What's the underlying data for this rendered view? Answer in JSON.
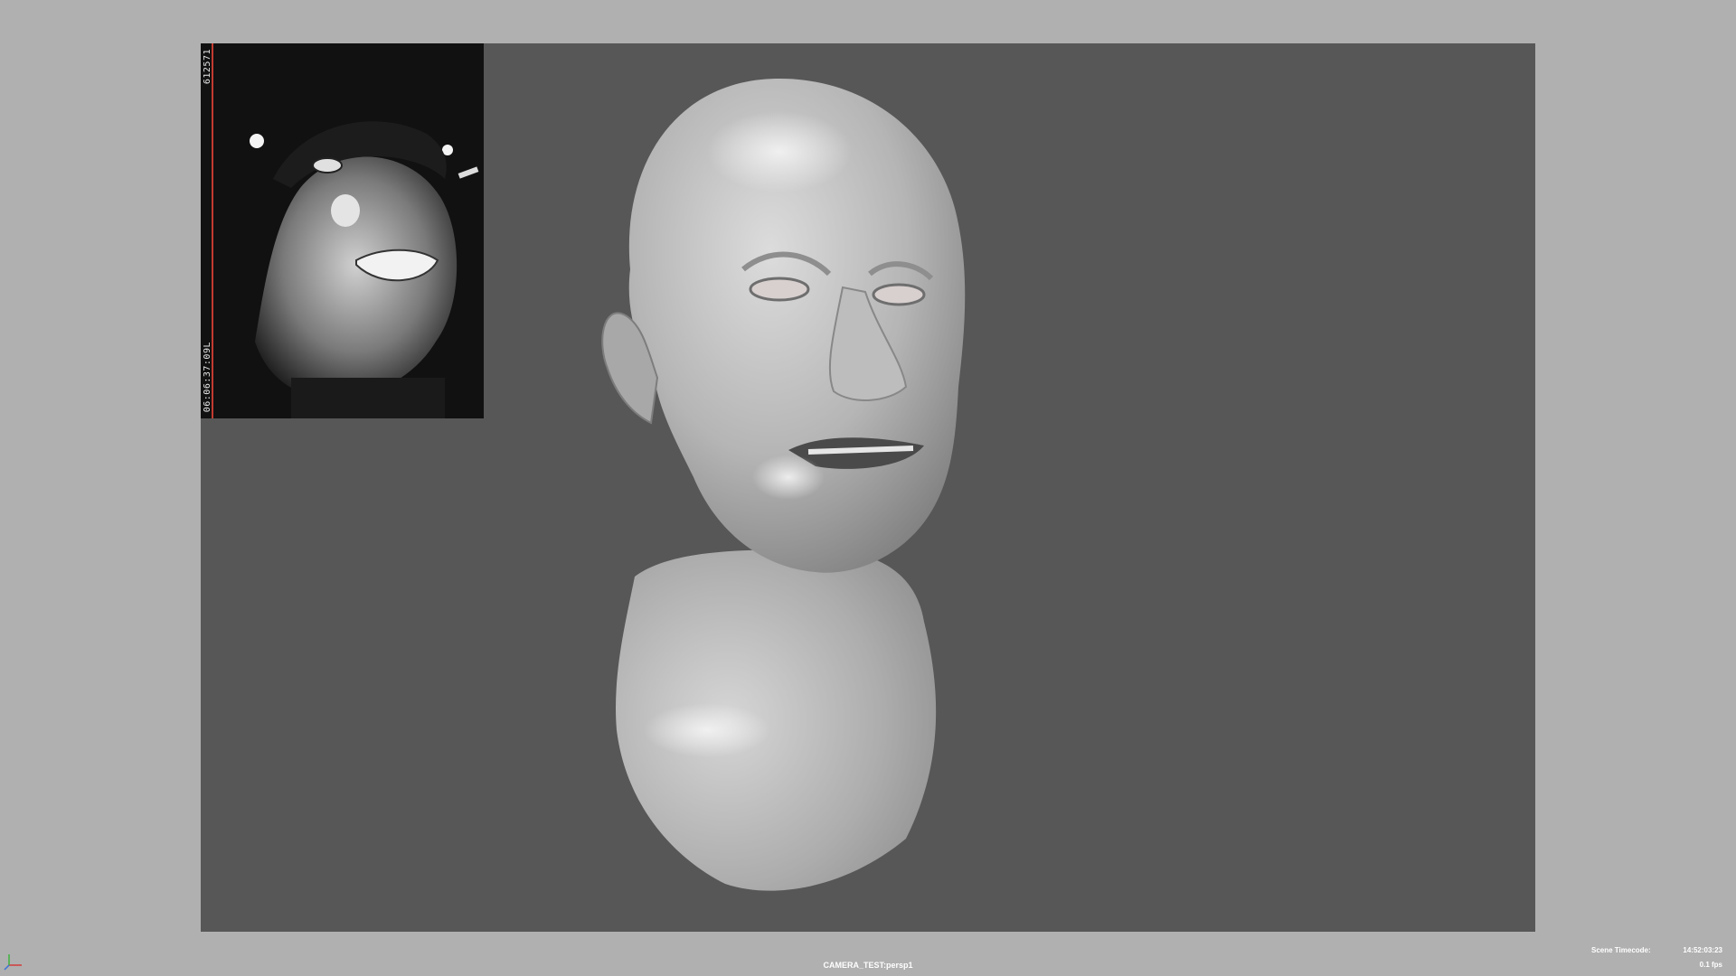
{
  "viewport": {
    "camera_name": "CAMERA_TEST:persp1",
    "background_color": "#575757",
    "frame_color": "#b0b0b0"
  },
  "reference_camera": {
    "frame_number": "612571",
    "timecode": "06:06:37:09L",
    "timeline_marker_color": "#c43a30"
  },
  "hud": {
    "scene_timecode_label": "Scene Timecode:",
    "scene_timecode_value": "14:52:03:23",
    "fps": "0.1 fps"
  },
  "icons": {
    "axis": "axis-gizmo-icon"
  }
}
